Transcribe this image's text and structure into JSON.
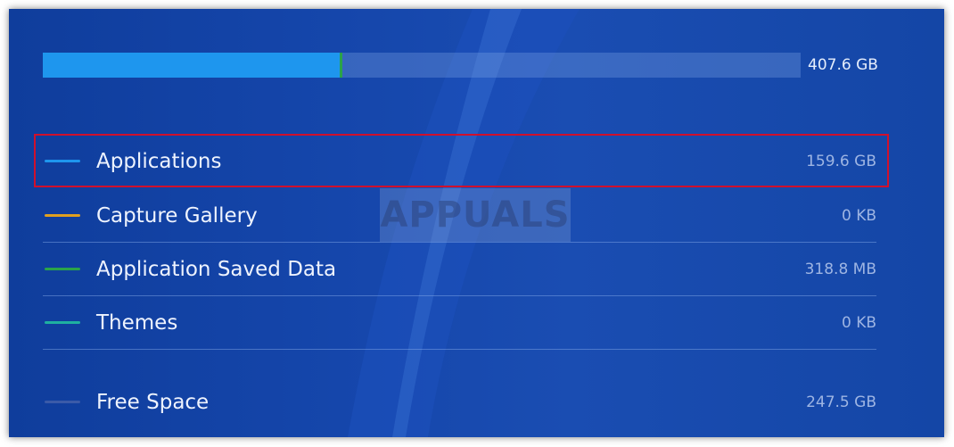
{
  "storage": {
    "total_label": "407.6 GB",
    "applications_fraction": 0.392,
    "saved_data_fraction": 0.0008
  },
  "categories": [
    {
      "label": "Applications",
      "value": "159.6 GB",
      "color": "#1e96ee"
    },
    {
      "label": "Capture Gallery",
      "value": "0 KB",
      "color": "#e0a020"
    },
    {
      "label": "Application Saved Data",
      "value": "318.8 MB",
      "color": "#2aa34a"
    },
    {
      "label": "Themes",
      "value": "0 KB",
      "color": "#1fb0a0"
    },
    {
      "label": "Free Space",
      "value": "247.5 GB",
      "color": "#3a5aa8"
    }
  ],
  "watermark": {
    "text": "APPUALS"
  },
  "colors": {
    "background": "#1546ab",
    "highlight": "#d0102c"
  }
}
